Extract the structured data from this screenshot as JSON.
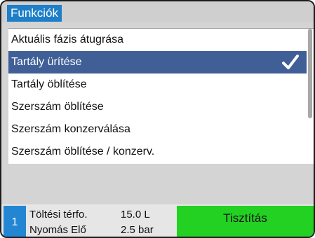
{
  "title": "Funkciók",
  "menu": {
    "items": [
      {
        "label": "Aktuális fázis átugrása"
      },
      {
        "label": "Tartály ürítése"
      },
      {
        "label": "Tartály öblítése"
      },
      {
        "label": "Szerszám öblítése"
      },
      {
        "label": "Szerszám konzerválása"
      },
      {
        "label": "Szerszám öblítése / konzerv."
      }
    ],
    "selected_index": 1
  },
  "status": {
    "step": "1",
    "rows": [
      {
        "label": "Töltési térfo.",
        "value": "15.0 L"
      },
      {
        "label": "Nyomás Elő",
        "value": "2.5 bar"
      }
    ],
    "action": {
      "label": "Tisztítás",
      "color": "#22d122"
    }
  },
  "colors": {
    "title_highlight": "#1e7fc8",
    "selection": "#3f5f96",
    "badge": "#2386d3"
  },
  "icons": {
    "selected_marker": "check-icon"
  }
}
